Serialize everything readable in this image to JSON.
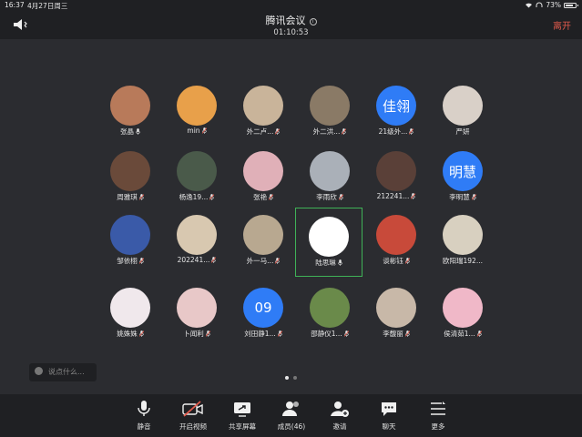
{
  "status": {
    "time": "16:37",
    "date": "4月27日周三",
    "battery": "73%"
  },
  "header": {
    "title": "腾讯会议",
    "timer": "01:10:53",
    "leave_label": "离开"
  },
  "participants": [
    {
      "name": "张晶",
      "avatar_text": "",
      "avatar_color": "#b87a5a",
      "mic": "on"
    },
    {
      "name": "min",
      "avatar_text": "",
      "avatar_color": "#e8a04a",
      "mic": "off"
    },
    {
      "name": "外二卢...",
      "avatar_text": "",
      "avatar_color": "#c9b49a",
      "mic": "off"
    },
    {
      "name": "外二洪...",
      "avatar_text": "",
      "avatar_color": "#8a7a66",
      "mic": "off"
    },
    {
      "name": "21级外...",
      "avatar_text": "佳翎",
      "avatar_color": "#2f7cf6",
      "mic": "off"
    },
    {
      "name": "严妍",
      "avatar_text": "",
      "avatar_color": "#d9d0c8",
      "mic": "none"
    },
    {
      "name": "周雅琪",
      "avatar_text": "",
      "avatar_color": "#6a4a3a",
      "mic": "off"
    },
    {
      "name": "杨逸19...",
      "avatar_text": "",
      "avatar_color": "#4a5a4a",
      "mic": "off"
    },
    {
      "name": "张艳",
      "avatar_text": "",
      "avatar_color": "#e0b0b8",
      "mic": "off"
    },
    {
      "name": "李雨欣",
      "avatar_text": "",
      "avatar_color": "#aab0b8",
      "mic": "off"
    },
    {
      "name": "212241...",
      "avatar_text": "",
      "avatar_color": "#5a4038",
      "mic": "off"
    },
    {
      "name": "李明慧",
      "avatar_text": "明慧",
      "avatar_color": "#2f7cf6",
      "mic": "off"
    },
    {
      "name": "邹依栩",
      "avatar_text": "",
      "avatar_color": "#3a5aa8",
      "mic": "off"
    },
    {
      "name": "202241...",
      "avatar_text": "",
      "avatar_color": "#d8c8b0",
      "mic": "off"
    },
    {
      "name": "外一马...",
      "avatar_text": "",
      "avatar_color": "#b8a890",
      "mic": "off"
    },
    {
      "name": "陆思琳",
      "avatar_text": "",
      "avatar_color": "#ffffff",
      "mic": "on"
    },
    {
      "name": "谈彬钰",
      "avatar_text": "",
      "avatar_color": "#c84a3a",
      "mic": "off"
    },
    {
      "name": "欧阳瑞192...",
      "avatar_text": "",
      "avatar_color": "#d8d0c0",
      "mic": "none"
    },
    {
      "name": "姚姝姝",
      "avatar_text": "",
      "avatar_color": "#f0e8ec",
      "mic": "off"
    },
    {
      "name": "卜闻利",
      "avatar_text": "",
      "avatar_color": "#e8c8c8",
      "mic": "off"
    },
    {
      "name": "刘田静1...",
      "avatar_text": "09",
      "avatar_color": "#2f7cf6",
      "mic": "off"
    },
    {
      "name": "邵静仪1...",
      "avatar_text": "",
      "avatar_color": "#6a8a4a",
      "mic": "off"
    },
    {
      "name": "李馥丽",
      "avatar_text": "",
      "avatar_color": "#c8b8a8",
      "mic": "off"
    },
    {
      "name": "侯清茹1...",
      "avatar_text": "",
      "avatar_color": "#f0b8c8",
      "mic": "off"
    }
  ],
  "chat": {
    "placeholder": "说点什么..."
  },
  "toolbar": {
    "mute": "静音",
    "video": "开启视频",
    "share": "共享屏幕",
    "members": "成员(46)",
    "invite": "邀请",
    "chat": "聊天",
    "more": "更多"
  },
  "colors": {
    "accent_blue": "#2f7cf6",
    "leave_red": "#e25a4c",
    "active_green": "#3fb257"
  }
}
